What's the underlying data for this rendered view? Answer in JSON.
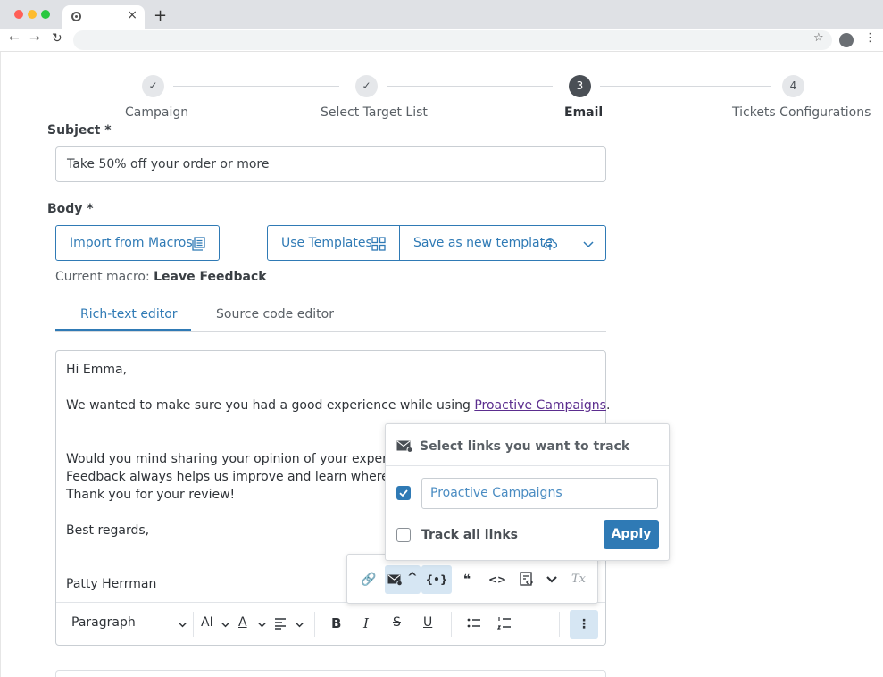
{
  "browser": {
    "tab_close": "×",
    "new_tab": "+",
    "back": "←",
    "forward": "→",
    "reload": "↻",
    "star": "☆",
    "menu": "⋮"
  },
  "stepper": {
    "steps": [
      {
        "label": "Campaign",
        "state": "done",
        "mark": "✓"
      },
      {
        "label": "Select Target List",
        "state": "done",
        "mark": "✓"
      },
      {
        "label": "Email",
        "state": "active",
        "mark": "3"
      },
      {
        "label": "Tickets Configurations",
        "state": "pending",
        "mark": "4"
      }
    ]
  },
  "subject": {
    "label": "Subject *",
    "value": "Take 50% off your order or more"
  },
  "body": {
    "label": "Body *",
    "import_macros": "Import from Macros",
    "use_templates": "Use Templates",
    "save_template": "Save as new template",
    "current_macro_prefix": "Current macro:",
    "current_macro_name": "Leave Feedback"
  },
  "editor_tabs": {
    "rich": "Rich-text editor",
    "source": "Source code editor"
  },
  "editor_content": {
    "greeting": "Hi Emma,",
    "line1_prefix": "We wanted to make sure you had a good experience while using ",
    "line1_link": "Proactive Campaigns",
    "line1_suffix": ".",
    "line2": "Would you mind sharing your opinion of your experience w",
    "line3": "Feedback always helps us improve and learn where we can",
    "line4": "Thank you for your review!",
    "closing": "Best regards,",
    "signature": "Patty Herrman"
  },
  "toolbar": {
    "paragraph": "Paragraph",
    "font_size": "AI",
    "font_color": "A",
    "bold": "B",
    "italic": "I",
    "strike": "S",
    "underline": "U",
    "more": "⋮"
  },
  "mini_toolbar": {
    "link": "🔗",
    "chevron_up": "^",
    "variable": "{•}",
    "quote": "❝",
    "code": "<>",
    "clear": "Tx"
  },
  "track_popup": {
    "title": "Select links you want to track",
    "link_value": "Proactive Campaigns",
    "link_checked": true,
    "track_all_label": "Track all links",
    "track_all_checked": false,
    "apply": "Apply"
  },
  "colors": {
    "accent": "#2f7ab5",
    "active_step": "#4a4f55",
    "link_visited": "#5b2d8e",
    "highlight": "#d6e6f3"
  }
}
